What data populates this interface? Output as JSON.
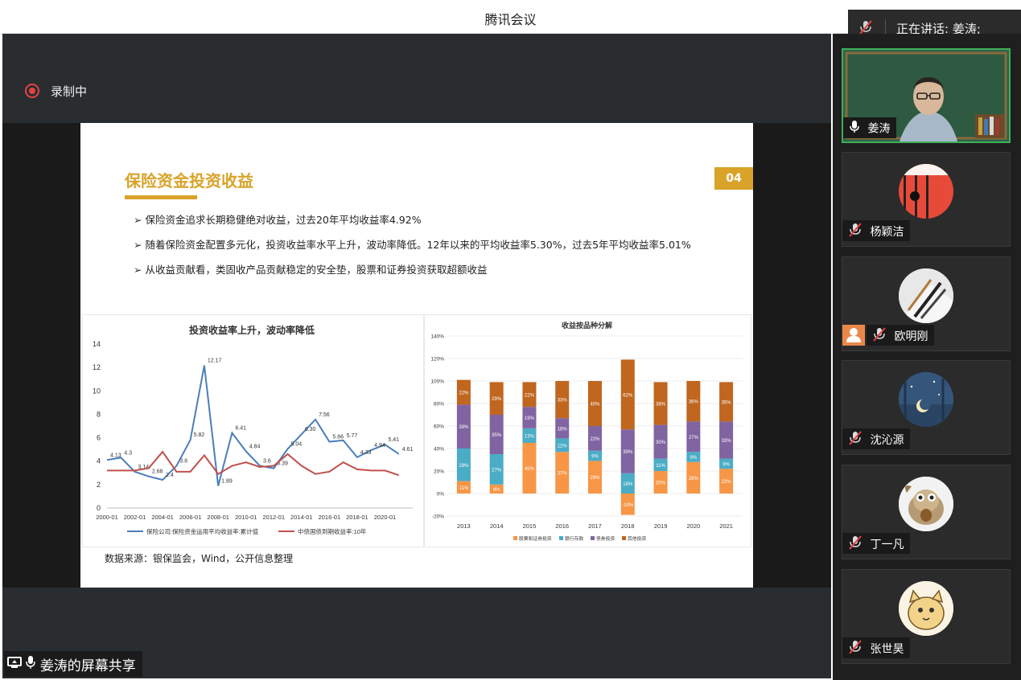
{
  "app": {
    "title": "腾讯会议"
  },
  "speaking": {
    "label": "正在讲话: 姜涛;",
    "icon": "mic-off-icon"
  },
  "recording": {
    "label": "录制中",
    "icon": "record-dot-icon"
  },
  "share_banner": {
    "label": "姜涛的屏幕共享",
    "icons": [
      "screen-share-icon",
      "mic-icon"
    ]
  },
  "slide": {
    "title": "保险资金投资收益",
    "page_number": "04",
    "bullets": [
      "保险资金追求长期稳健绝对收益，过去20年平均收益率4.92%",
      "随着保险资金配置多元化，投资收益率水平上升，波动率降低。12年以来的平均收益率5.30%，过去5年平均收益率5.01%",
      "从收益贡献看，类固收产品贡献稳定的安全垫，股票和证券投资获取超额收益"
    ],
    "source": "数据来源：银保监会，Wind，公开信息整理"
  },
  "chart_data": [
    {
      "type": "line",
      "title": "投资收益率上升，波动率降低",
      "ylim": [
        0,
        14
      ],
      "yticks": [
        0,
        2,
        4,
        6,
        8,
        10,
        12,
        14
      ],
      "xticks": [
        "2000-01",
        "2002-01",
        "2004-01",
        "2006-01",
        "2008-01",
        "2010-01",
        "2012-01",
        "2014-01",
        "2016-01",
        "2018-01",
        "2020-01"
      ],
      "x": [
        2000,
        2001,
        2002,
        2003,
        2004,
        2005,
        2006,
        2007,
        2008,
        2009,
        2010,
        2011,
        2012,
        2013,
        2014,
        2015,
        2016,
        2017,
        2018,
        2019,
        2020,
        2021
      ],
      "series": [
        {
          "name": "保险公司:保险资金运用平均收益率:累计值",
          "color": "#4a7ebb",
          "values": [
            4.1,
            4.3,
            3.1,
            2.7,
            2.4,
            3.6,
            5.82,
            12.17,
            1.89,
            6.41,
            4.84,
            3.6,
            3.39,
            5.04,
            6.3,
            7.56,
            5.66,
            5.77,
            4.33,
            4.94,
            5.41,
            4.61
          ],
          "labels": [
            "4.13",
            "4.3",
            "3.14",
            "2.68",
            "2.4",
            "3.6",
            "5.82",
            "12.17",
            "1.89",
            "6.41",
            "4.84",
            "3.6",
            "3.39",
            "5.04",
            "6.30",
            "7.56",
            "5.66",
            "5.77",
            "4.33",
            "4.94",
            "5.41",
            "4.61"
          ]
        },
        {
          "name": "中债国债到期收益率:10年",
          "color": "#c0504d",
          "values": [
            3.2,
            3.2,
            3.2,
            3.4,
            4.8,
            3.1,
            3.1,
            4.5,
            2.9,
            3.6,
            3.9,
            3.5,
            3.6,
            4.6,
            3.6,
            2.9,
            3.1,
            3.9,
            3.3,
            3.2,
            3.2,
            2.8
          ]
        }
      ]
    },
    {
      "type": "bar",
      "stacked": true,
      "title": "收益按品种分解",
      "ylim": [
        -20,
        140
      ],
      "yticks": [
        "-20%",
        "0%",
        "20%",
        "40%",
        "60%",
        "80%",
        "100%",
        "120%",
        "140%"
      ],
      "categories": [
        "2013",
        "2014",
        "2015",
        "2016",
        "2017",
        "2018",
        "2019",
        "2020",
        "2021"
      ],
      "series": [
        {
          "name": "股票和证券投资",
          "color": "#f79646",
          "values": [
            11,
            8,
            45,
            37,
            29,
            -19,
            20,
            28,
            22
          ],
          "labels": [
            "11%",
            "8%",
            "45%",
            "37%",
            "29%",
            "-19%",
            "20%",
            "28%",
            "22%"
          ]
        },
        {
          "name": "银行存款",
          "color": "#4bacc6",
          "values": [
            29,
            27,
            13,
            12,
            9,
            18,
            11,
            9,
            9
          ],
          "labels": [
            "29%",
            "27%",
            "13%",
            "12%",
            "9%",
            "18%",
            "11%",
            "9%",
            "9%"
          ]
        },
        {
          "name": "债券投资",
          "color": "#8064a2",
          "values": [
            39,
            35,
            19,
            18,
            22,
            39,
            30,
            27,
            33
          ],
          "labels": [
            "39%",
            "35%",
            "19%",
            "18%",
            "22%",
            "39%",
            "30%",
            "27%",
            "33%"
          ]
        },
        {
          "name": "其他投资",
          "color": "#c0661f",
          "values": [
            22,
            29,
            22,
            33,
            40,
            62,
            38,
            36,
            35
          ],
          "labels": [
            "22%",
            "29%",
            "22%",
            "33%",
            "40%",
            "62%",
            "38%",
            "36%",
            "35%"
          ]
        }
      ]
    }
  ],
  "participants": [
    {
      "name": "姜涛",
      "mic": "mic-on-icon",
      "video": true,
      "active": true,
      "avatar": "teacher-video"
    },
    {
      "name": "杨颖洁",
      "mic": "mic-off-icon",
      "video": false,
      "active": false,
      "avatar": "red-flag-avatar",
      "avatar_color": "#e84a3a"
    },
    {
      "name": "欧明刚",
      "mic": "mic-off-icon",
      "video": false,
      "active": false,
      "host": true,
      "avatar": "pens-avatar",
      "avatar_color": "#b9b9b9"
    },
    {
      "name": "沈沁源",
      "mic": "mic-off-icon",
      "video": false,
      "active": false,
      "avatar": "night-sky-avatar",
      "avatar_color": "#3a5f86"
    },
    {
      "name": "丁一凡",
      "mic": "mic-off-icon",
      "video": false,
      "active": false,
      "avatar": "squirrel-avatar",
      "avatar_color": "#c8b08a"
    },
    {
      "name": "张世昊",
      "mic": "mic-off-icon",
      "video": false,
      "active": false,
      "avatar": "cartoon-cat-avatar",
      "avatar_color": "#f3d38a"
    }
  ]
}
